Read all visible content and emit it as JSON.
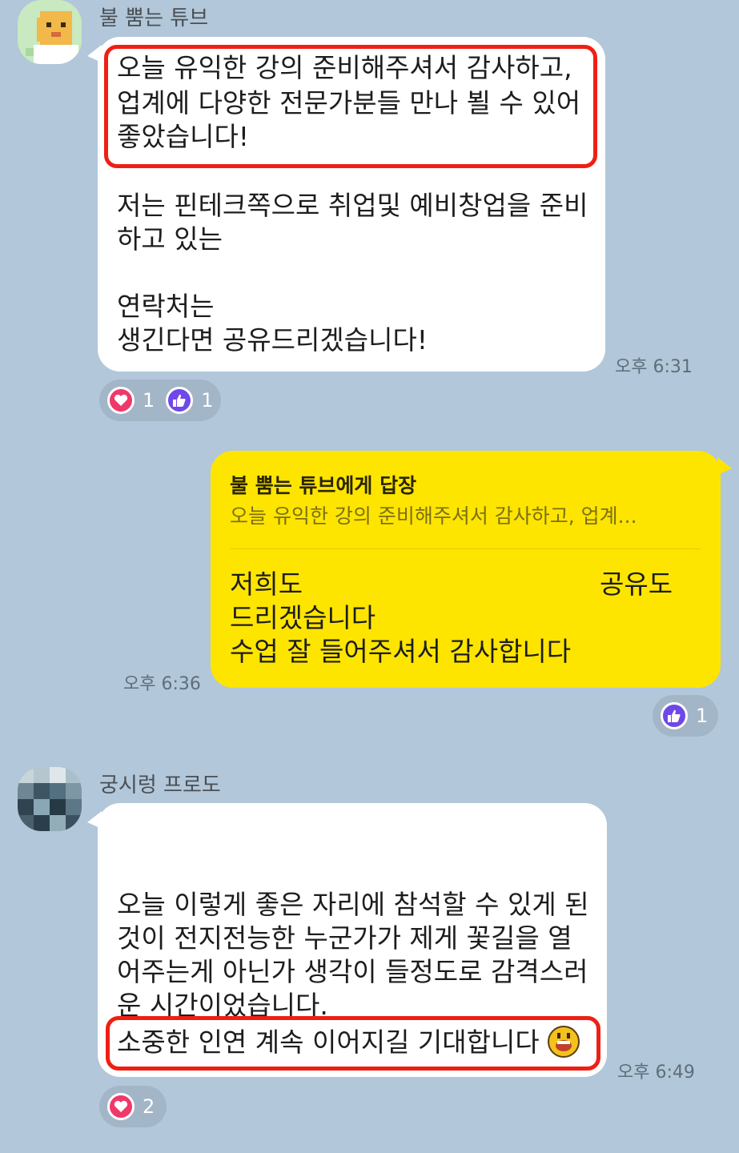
{
  "messages": [
    {
      "sender": "불 뿜는 튜브",
      "avatar_icon": "tube-avatar-icon",
      "lines": [
        "오늘 유익한 강의 준비해주셔서 감사하고,",
        "업계에 다양한 전문가분들 만나 뵐 수 있어",
        "좋았습니다!",
        "저는 핀테크쪽으로 취업및 예비창업을 준비",
        "하고 있는",
        "연락처는",
        "생긴다면 공유드리겠습니다!"
      ],
      "time": "오후 6:31",
      "reactions": [
        {
          "icon": "heart-icon",
          "count": "1"
        },
        {
          "icon": "thumbs-up-icon",
          "count": "1"
        }
      ]
    },
    {
      "sender": "me",
      "reply": {
        "to": "불 뿜는 튜브에게 답장",
        "preview": "오늘 유익한 강의 준비해주셔서 감사하고, 업계..."
      },
      "lines": [
        "저희도",
        "공유도",
        "드리겠습니다",
        "수업 잘 들어주셔서 감사합니다"
      ],
      "time": "오후 6:36",
      "reactions": [
        {
          "icon": "thumbs-up-icon",
          "count": "1"
        }
      ]
    },
    {
      "sender": "궁시렁 프로도",
      "avatar_icon": "frodo-avatar-icon",
      "lines": [
        "오늘 이렇게 좋은 자리에 참석할 수 있게 된",
        "것이 전지전능한 누군가가 제게 꽃길을 열",
        "어주는게 아닌가 생각이 들정도로 감격스러",
        "운 시간이었습니다.",
        "소중한 인연 계속 이어지길 기대합니다"
      ],
      "emoticon": "laughing-emoticon-icon",
      "time": "오후 6:49",
      "reactions": [
        {
          "icon": "heart-icon",
          "count": "2"
        }
      ]
    }
  ],
  "colors": {
    "chat_background": "#b2c7d9",
    "my_bubble": "#fee500",
    "other_bubble": "#ffffff",
    "highlight": "#ef1f14",
    "heart": "#f0386a",
    "thumb": "#6e48e8"
  }
}
